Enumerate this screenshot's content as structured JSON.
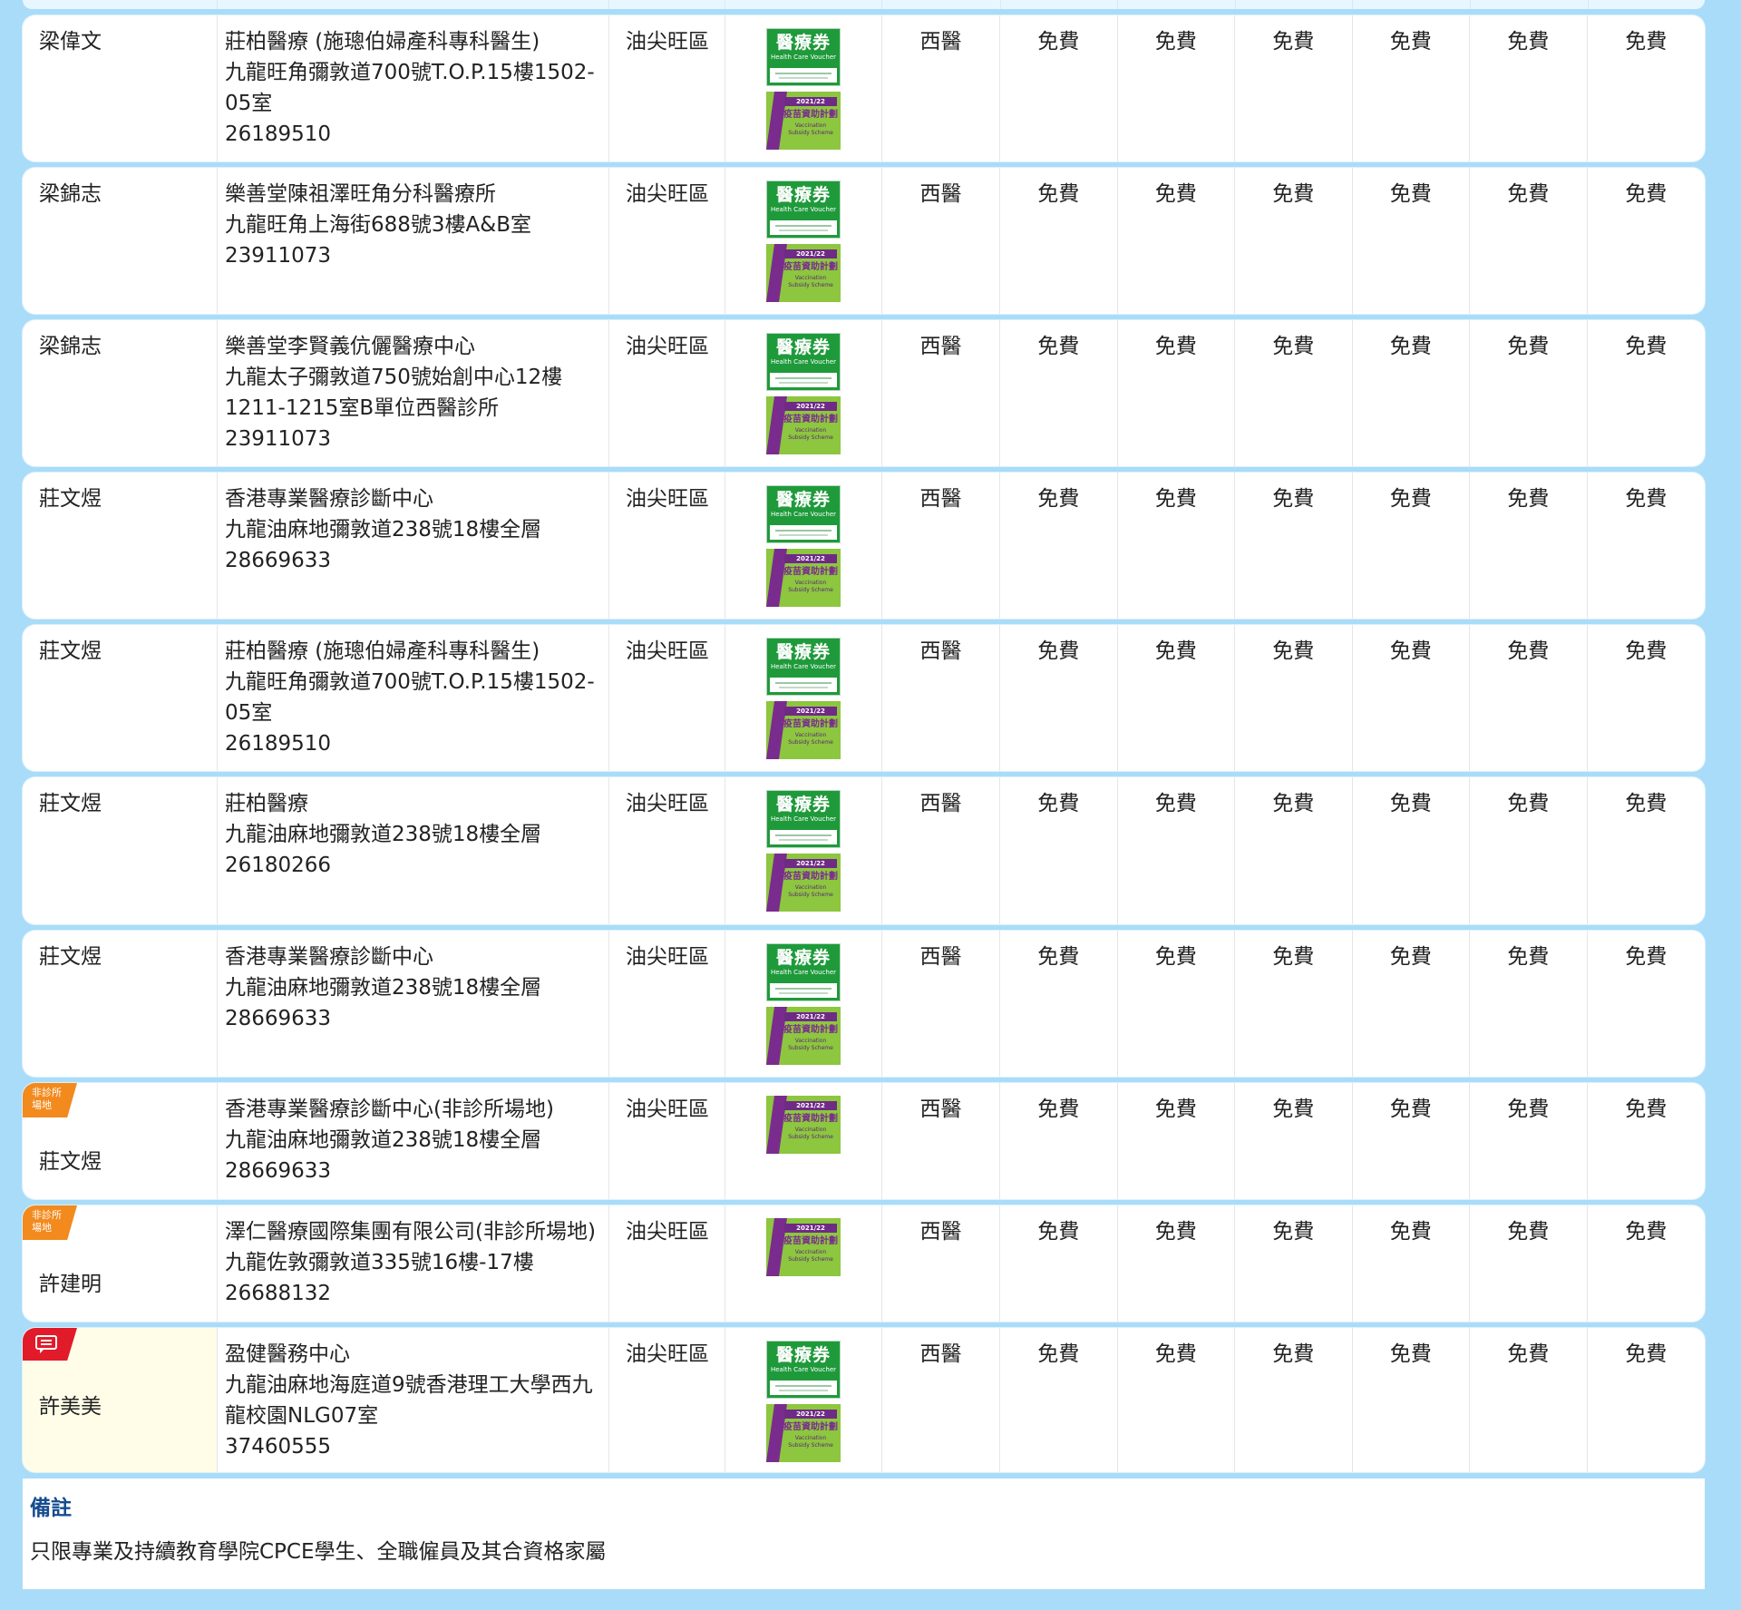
{
  "rows": [
    {
      "doctor": "梁偉文",
      "clinic": "莊柏醫療 (施璁伯婦產科專科醫生)",
      "address": [
        "九龍旺角彌敦道700號T.O.P.15樓1502-",
        "05室"
      ],
      "phone": "26189510",
      "district": "油尖旺區",
      "hcv": true,
      "tag": null,
      "type": "西醫",
      "fees": [
        "免費",
        "免費",
        "免費",
        "免費",
        "免費",
        "免費"
      ]
    },
    {
      "doctor": "梁錦志",
      "clinic": "樂善堂陳祖澤旺角分科醫療所",
      "address": [
        "九龍旺角上海街688號3樓A&B室"
      ],
      "phone": "23911073",
      "district": "油尖旺區",
      "hcv": true,
      "tag": null,
      "type": "西醫",
      "fees": [
        "免費",
        "免費",
        "免費",
        "免費",
        "免費",
        "免費"
      ]
    },
    {
      "doctor": "梁錦志",
      "clinic": "樂善堂李賢義伉儷醫療中心",
      "address": [
        "九龍太子彌敦道750號始創中心12樓",
        "1211-1215室B單位西醫診所"
      ],
      "phone": "23911073",
      "district": "油尖旺區",
      "hcv": true,
      "tag": null,
      "type": "西醫",
      "fees": [
        "免費",
        "免費",
        "免費",
        "免費",
        "免費",
        "免費"
      ]
    },
    {
      "doctor": "莊文煜",
      "clinic": "香港專業醫療診斷中心",
      "address": [
        "九龍油麻地彌敦道238號18樓全層"
      ],
      "phone": "28669633",
      "district": "油尖旺區",
      "hcv": true,
      "tag": null,
      "type": "西醫",
      "fees": [
        "免費",
        "免費",
        "免費",
        "免費",
        "免費",
        "免費"
      ]
    },
    {
      "doctor": "莊文煜",
      "clinic": "莊柏醫療 (施璁伯婦產科專科醫生)",
      "address": [
        "九龍旺角彌敦道700號T.O.P.15樓1502-",
        "05室"
      ],
      "phone": "26189510",
      "district": "油尖旺區",
      "hcv": true,
      "tag": null,
      "type": "西醫",
      "fees": [
        "免費",
        "免費",
        "免費",
        "免費",
        "免費",
        "免費"
      ]
    },
    {
      "doctor": "莊文煜",
      "clinic": "莊柏醫療",
      "address": [
        "九龍油麻地彌敦道238號18樓全層"
      ],
      "phone": "26180266",
      "district": "油尖旺區",
      "hcv": true,
      "tag": null,
      "type": "西醫",
      "fees": [
        "免費",
        "免費",
        "免費",
        "免費",
        "免費",
        "免費"
      ]
    },
    {
      "doctor": "莊文煜",
      "clinic": "香港專業醫療診斷中心",
      "address": [
        "九龍油麻地彌敦道238號18樓全層"
      ],
      "phone": "28669633",
      "district": "油尖旺區",
      "hcv": true,
      "tag": null,
      "type": "西醫",
      "fees": [
        "免費",
        "免費",
        "免費",
        "免費",
        "免費",
        "免費"
      ]
    },
    {
      "doctor": "莊文煜",
      "clinic": "香港專業醫療診斷中心(非診所場地)",
      "address": [
        "九龍油麻地彌敦道238號18樓全層"
      ],
      "phone": "28669633",
      "district": "油尖旺區",
      "hcv": false,
      "tag": "venue",
      "type": "西醫",
      "fees": [
        "免費",
        "免費",
        "免費",
        "免費",
        "免費",
        "免費"
      ]
    },
    {
      "doctor": "許建明",
      "clinic": "澤仁醫療國際集團有限公司(非診所場地)",
      "address": [
        "九龍佐敦彌敦道335號16樓-17樓"
      ],
      "phone": "26688132",
      "district": "油尖旺區",
      "hcv": false,
      "tag": "venue",
      "type": "西醫",
      "fees": [
        "免費",
        "免費",
        "免費",
        "免費",
        "免費",
        "免費"
      ]
    },
    {
      "doctor": "許美美",
      "clinic": "盈健醫務中心",
      "address": [
        "九龍油麻地海庭道9號香港理工大學西九",
        "龍校園NLG07室"
      ],
      "phone": "37460555",
      "district": "油尖旺區",
      "hcv": true,
      "tag": "memo",
      "type": "西醫",
      "fees": [
        "免費",
        "免費",
        "免費",
        "免費",
        "免費",
        "免費"
      ]
    }
  ],
  "tags": {
    "venue_line1": "非診所",
    "venue_line2": "場地"
  },
  "badges": {
    "hcv_cn": "醫療券",
    "hcv_en": "Health Care Voucher",
    "vss_year": "2021/22",
    "vss_cn": "疫苗資助計劃",
    "vss_en1": "Vaccination",
    "vss_en2": "Subsidy Scheme"
  },
  "remarks": {
    "title": "備註",
    "text": "只限專業及持續教育學院CPCE學生、全職僱員及其合資格家屬"
  }
}
